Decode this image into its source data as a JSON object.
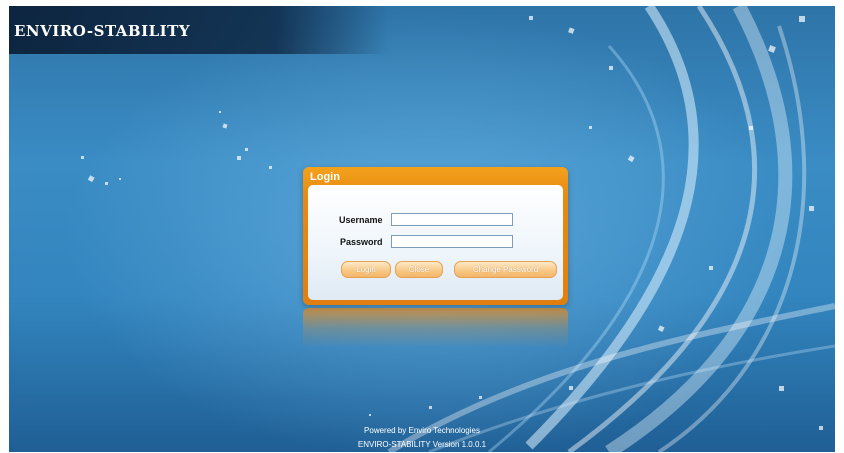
{
  "app": {
    "title": "ENVIRO-STABILITY"
  },
  "login": {
    "header": "Login",
    "username_label": "Username",
    "password_label": "Password",
    "username_value": "",
    "password_value": "",
    "buttons": {
      "login": "Login",
      "close": "Close",
      "change_password": "Change Password"
    }
  },
  "footer": {
    "powered_by": "Powered by Enviro Technologies",
    "version": "ENVIRO-STABILITY Version 1.0.0.1"
  },
  "colors": {
    "background": "#3385bf",
    "panel_accent": "#e98a12",
    "button": "#f8c987"
  }
}
